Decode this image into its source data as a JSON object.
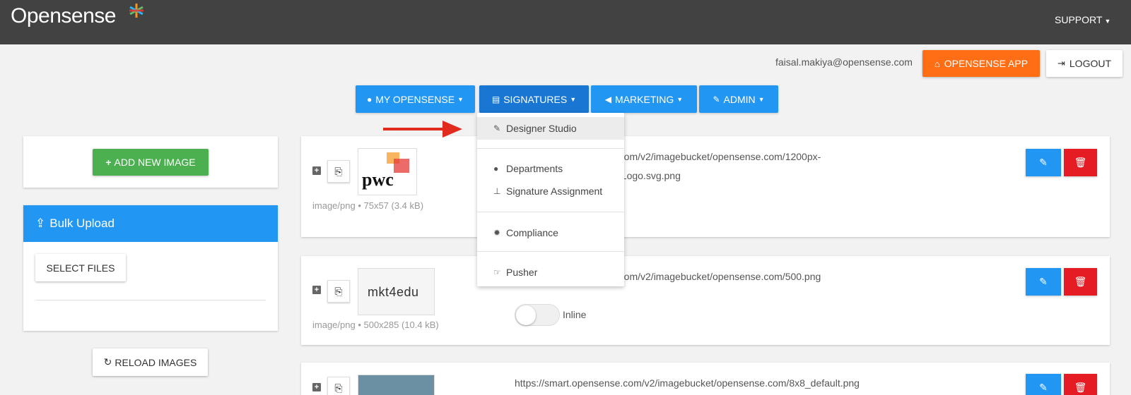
{
  "topbar": {
    "logo": "Opensense",
    "support_label": "SUPPORT"
  },
  "account": {
    "email": "faisal.makiya@opensense.com",
    "app_label": "OPENSENSE APP",
    "logout_label": "LOGOUT"
  },
  "nav": [
    {
      "label": "MY OPENSENSE",
      "icon": "user-icon"
    },
    {
      "label": "SIGNATURES",
      "icon": "id-card-icon"
    },
    {
      "label": "MARKETING",
      "icon": "bullhorn-icon"
    },
    {
      "label": "ADMIN",
      "icon": "wrench-icon"
    }
  ],
  "dropdown": [
    {
      "label": "Designer Studio",
      "icon": "brush-icon"
    },
    {
      "label": "Departments",
      "icon": "users-icon"
    },
    {
      "label": "Signature Assignment",
      "icon": "sitemap-icon"
    },
    {
      "label": "Compliance",
      "icon": "certificate-icon"
    },
    {
      "label": "Pusher",
      "icon": "pointer-icon"
    }
  ],
  "sidebar": {
    "add_label": "ADD NEW IMAGE",
    "bulk_title": "Bulk Upload",
    "select_label": "SELECT FILES",
    "reload_label": "RELOAD IMAGES"
  },
  "images": [
    {
      "meta": "image/png • 75x57 (3.4 kB)",
      "url_line1": "e.com/v2/imagebucket/opensense.com/1200px-",
      "url_line2": "s_Logo.svg.png",
      "thumb_text": "pwc"
    },
    {
      "meta": "image/png • 500x285 (10.4 kB)",
      "url_line1": "e.com/v2/imagebucket/opensense.com/500.png",
      "toggle_label": "Inline",
      "thumb_text": "mkt4edu"
    },
    {
      "url_line1": "https://smart.opensense.com/v2/imagebucket/opensense.com/8x8_default.png"
    }
  ],
  "colors": {
    "topbar": "#424242",
    "primary": "#2196f3",
    "orange": "#ff6d14",
    "green": "#4caf50",
    "danger": "#e51c23"
  }
}
